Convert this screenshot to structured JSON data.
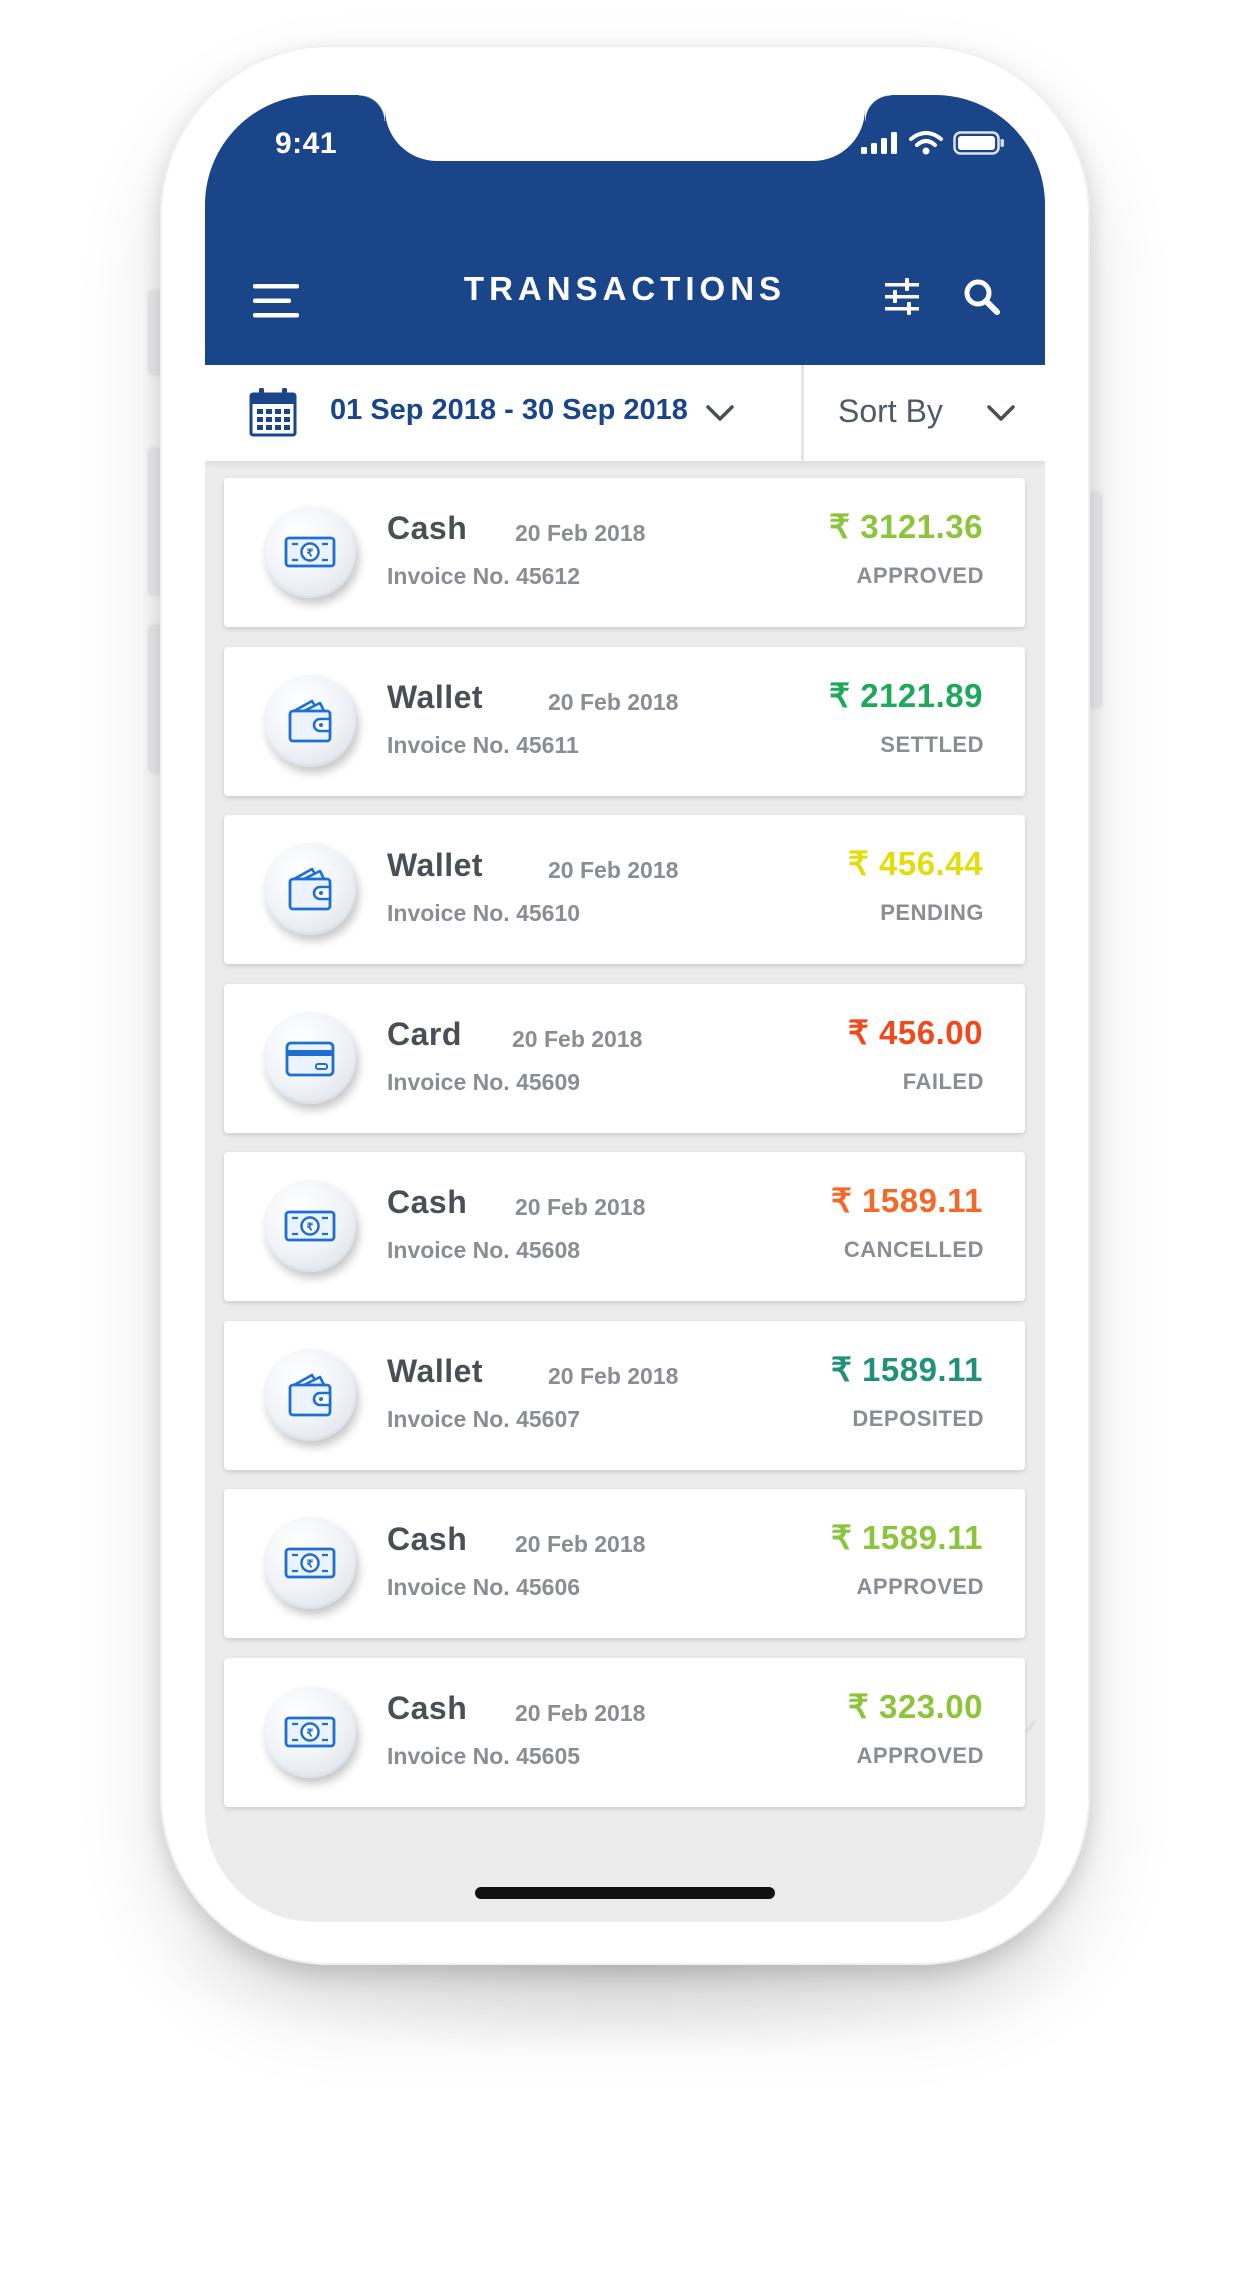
{
  "status_bar": {
    "time": "9:41"
  },
  "header": {
    "title": "TRANSACTIONS"
  },
  "filter_bar": {
    "date_range": "01 Sep 2018 - 30 Sep 2018",
    "sort_label": "Sort By"
  },
  "icons": {
    "menu": "hamburger-menu-icon",
    "filter": "sliders-icon",
    "search": "search-icon",
    "calendar": "calendar-icon",
    "cash": "cash-icon",
    "wallet": "wallet-icon",
    "card": "credit-card-icon"
  },
  "colors": {
    "header": "#1a4589",
    "approved": "#8cc43c",
    "settled": "#1ea85a",
    "pending": "#e2dd0f",
    "failed": "#f04a1c",
    "cancelled": "#f36a28",
    "deposited": "#23907c"
  },
  "transactions": [
    {
      "type": "cash",
      "name": "Cash",
      "date": "20 Feb 2018",
      "invoice": "Invoice No. 45612",
      "amount": "₹ 3121.36",
      "status": "APPROVED",
      "color": "#8cc43c"
    },
    {
      "type": "wallet",
      "name": "Wallet",
      "date": "20 Feb 2018",
      "invoice": "Invoice No. 45611",
      "amount": "₹ 2121.89",
      "status": "SETTLED",
      "color": "#1ea85a"
    },
    {
      "type": "wallet",
      "name": "Wallet",
      "date": "20 Feb 2018",
      "invoice": "Invoice No. 45610",
      "amount": "₹ 456.44",
      "status": "PENDING",
      "color": "#e2dd0f"
    },
    {
      "type": "card",
      "name": "Card",
      "date": "20 Feb 2018",
      "invoice": "Invoice No. 45609",
      "amount": "₹ 456.00",
      "status": "FAILED",
      "color": "#f04a1c"
    },
    {
      "type": "cash",
      "name": "Cash",
      "date": "20 Feb 2018",
      "invoice": "Invoice No. 45608",
      "amount": "₹ 1589.11",
      "status": "CANCELLED",
      "color": "#f36a28"
    },
    {
      "type": "wallet",
      "name": "Wallet",
      "date": "20 Feb 2018",
      "invoice": "Invoice No. 45607",
      "amount": "₹ 1589.11",
      "status": "DEPOSITED",
      "color": "#23907c"
    },
    {
      "type": "cash",
      "name": "Cash",
      "date": "20 Feb 2018",
      "invoice": "Invoice No. 45606",
      "amount": "₹ 1589.11",
      "status": "APPROVED",
      "color": "#8cc43c"
    },
    {
      "type": "cash",
      "name": "Cash",
      "date": "20 Feb 2018",
      "invoice": "Invoice No. 45605",
      "amount": "₹ 323.00",
      "status": "APPROVED",
      "color": "#8cc43c"
    }
  ]
}
